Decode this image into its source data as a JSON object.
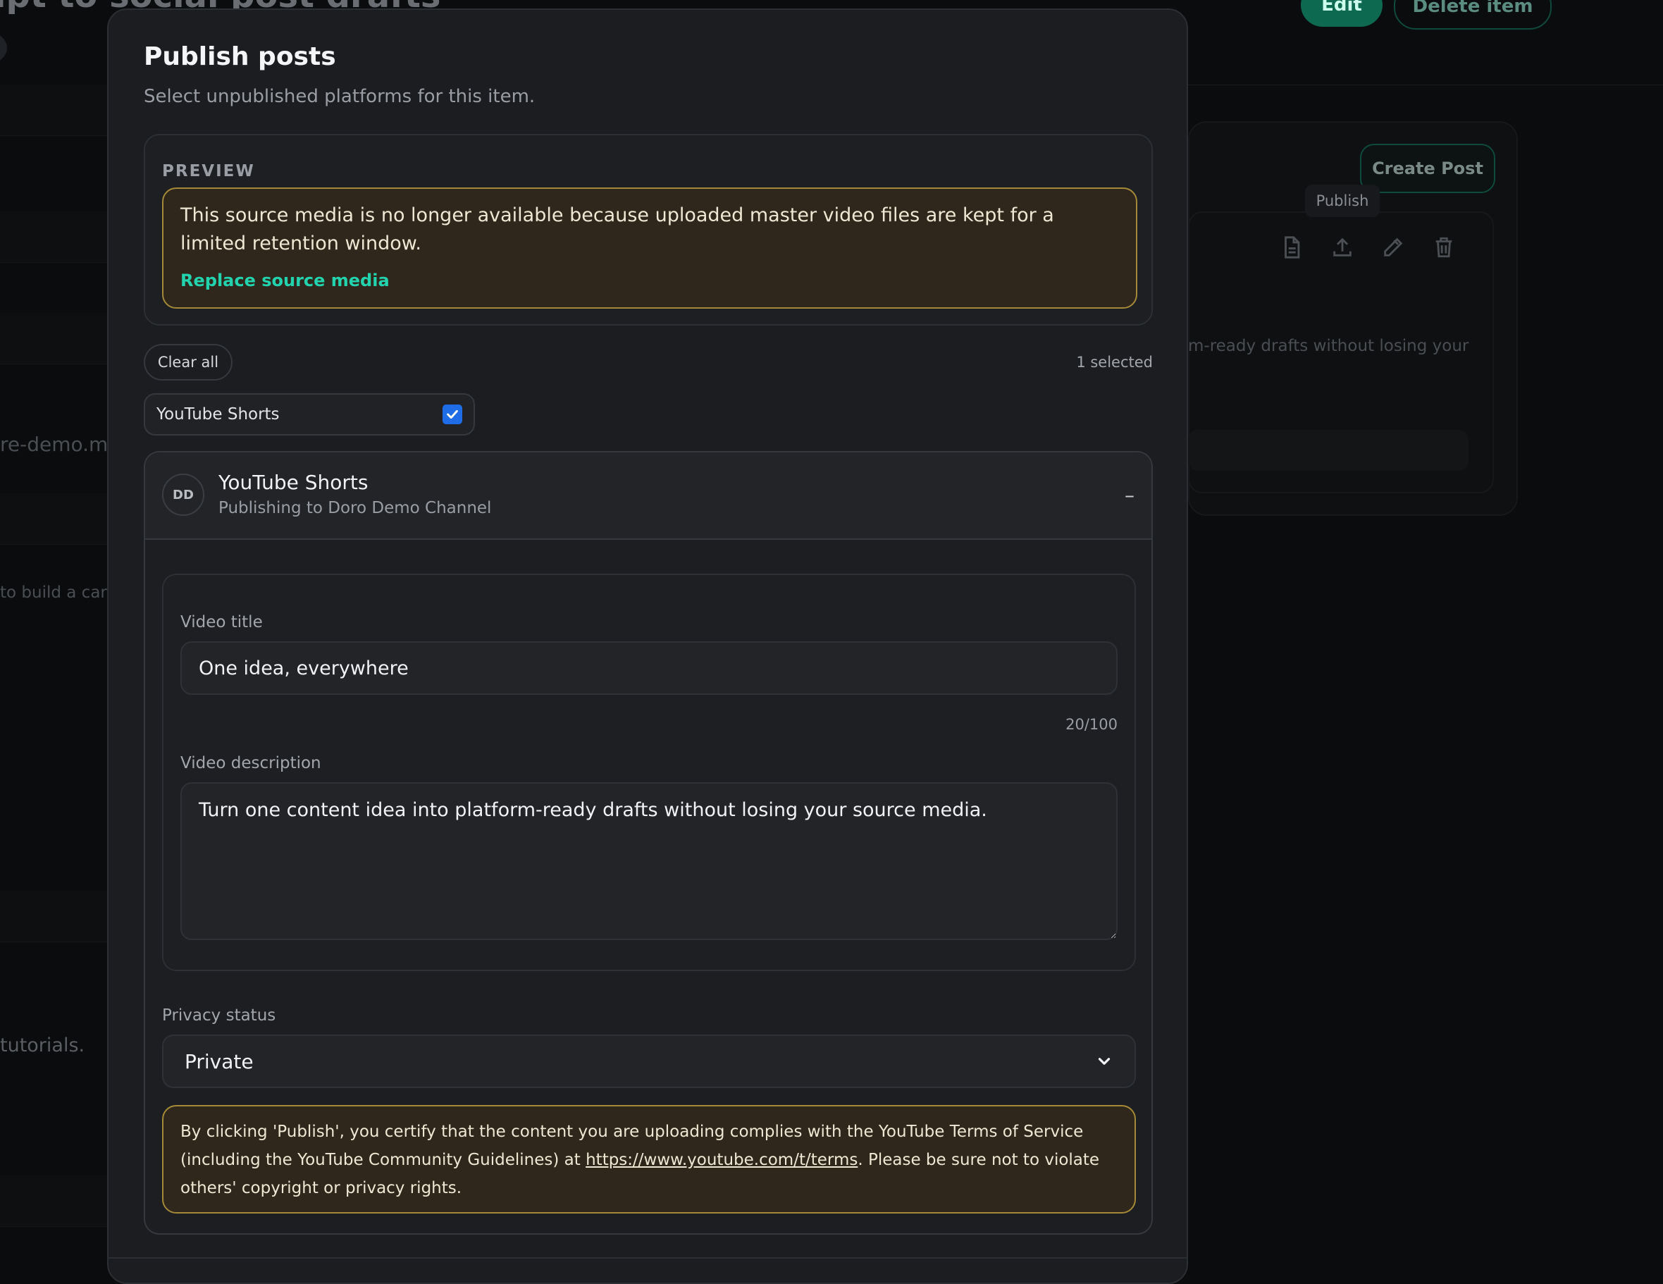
{
  "background": {
    "page_title": "ipt to social post drafts",
    "edit_label": "Edit",
    "delete_label": "Delete item",
    "left_snippet_1": "re-demo.mp",
    "left_snippet_2": "to build a caro",
    "left_snippet_3": "tutorials.",
    "create_post_label": "Create Post",
    "tooltip_publish": "Publish",
    "card_text": "m-ready drafts without losing your"
  },
  "modal": {
    "title": "Publish posts",
    "subtitle": "Select unpublished platforms for this item.",
    "preview": {
      "label": "PREVIEW",
      "warning": "This source media is no longer available because uploaded master video files are kept for a limited retention window.",
      "replace_link": "Replace source media"
    },
    "clear_all_label": "Clear all",
    "selected_count": "1 selected",
    "chips": [
      {
        "label": "YouTube Shorts",
        "checked": true
      }
    ],
    "platform": {
      "avatar_initials": "DD",
      "name": "YouTube Shorts",
      "channel": "Publishing to Doro Demo Channel",
      "collapse_symbol": "–",
      "video_title_label": "Video title",
      "video_title_value": "One idea, everywhere",
      "video_title_counter": "20/100",
      "video_description_label": "Video description",
      "video_description_value": "Turn one content idea into platform-ready drafts without losing your source media.",
      "privacy_label": "Privacy status",
      "privacy_value": "Private",
      "terms_before": "By clicking 'Publish', you certify that the content you are uploading complies with the YouTube Terms of Service (including the YouTube Community Guidelines) at ",
      "terms_link": "https://www.youtube.com/t/terms",
      "terms_after": ". Please be sure not to violate others' copyright or privacy rights."
    }
  },
  "colors": {
    "accent": "#23d3ae",
    "checkbox": "#1e6de6",
    "warning_border": "#a48a38",
    "warning_bg": "#2f271c"
  }
}
